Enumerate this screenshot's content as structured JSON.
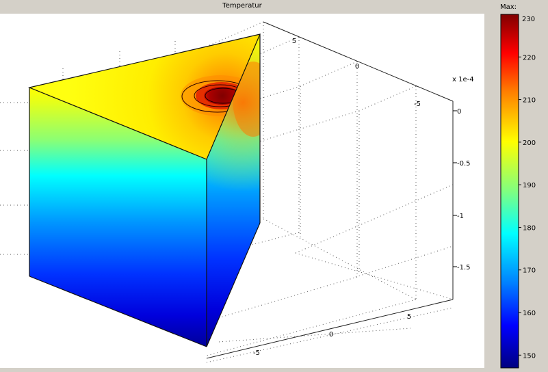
{
  "chart_data": {
    "type": "heatmap",
    "title": "Temperatur",
    "variant": "3D volume slice of a triangular prism, colored by temperature, with contour rings near the heat source",
    "colormap": "jet",
    "colorbar": {
      "label": "Max:",
      "max_value": "230",
      "range": [
        147,
        230
      ],
      "ticks": [
        "220",
        "210",
        "200",
        "190",
        "180",
        "170",
        "160",
        "150"
      ]
    },
    "axes": {
      "x_ticks": [
        "5",
        "0",
        "-5"
      ],
      "y_ticks": [
        "5",
        "0",
        "-5"
      ],
      "z_ticks": [
        "0",
        "-0.5",
        "-1",
        "-1.5"
      ],
      "z_multiplier": "× 1e-4"
    },
    "field": {
      "top_surface_value": 200,
      "hotspot_peak": 230,
      "side_gradient_top": 200,
      "side_gradient_bottom": 150
    },
    "grid": true
  }
}
